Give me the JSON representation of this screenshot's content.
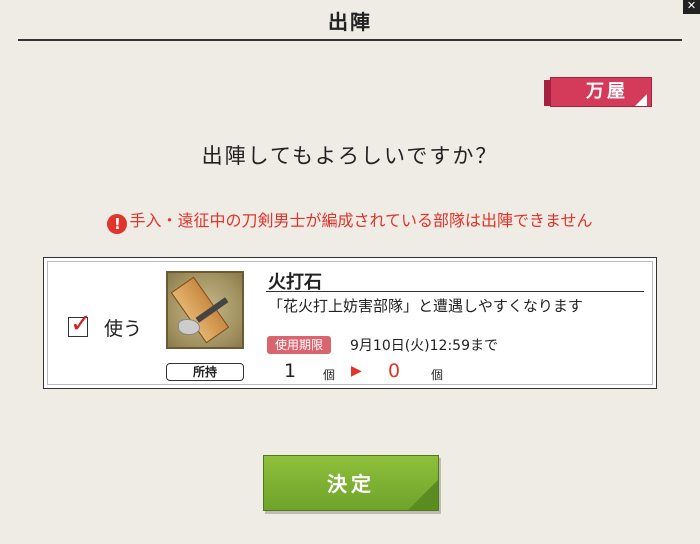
{
  "dialog": {
    "title": "出陣",
    "close_icon": "close-icon",
    "shop_label": "万屋",
    "question": "出陣してもよろしいですか？",
    "warning_icon": "exclamation-icon",
    "warning": "手入・遠征中の刀剣男士が編成されている部隊は出陣できません"
  },
  "item": {
    "use_checked": true,
    "use_label": "使う",
    "icon": "whetstone-item-icon",
    "name": "火打石",
    "description": "「花火打上妨害部隊」と遭遇しやすくなります",
    "expiry_badge": "使用期限",
    "expiry_text": "9月10日(火)12:59まで",
    "owned_label": "所持",
    "count_now": "1",
    "count_after": "0",
    "unit": "個"
  },
  "confirm_label": "決定",
  "colors": {
    "accent_red": "#e0352b",
    "confirm_green": "#7bb231",
    "shop_pink": "#d43a5a"
  }
}
